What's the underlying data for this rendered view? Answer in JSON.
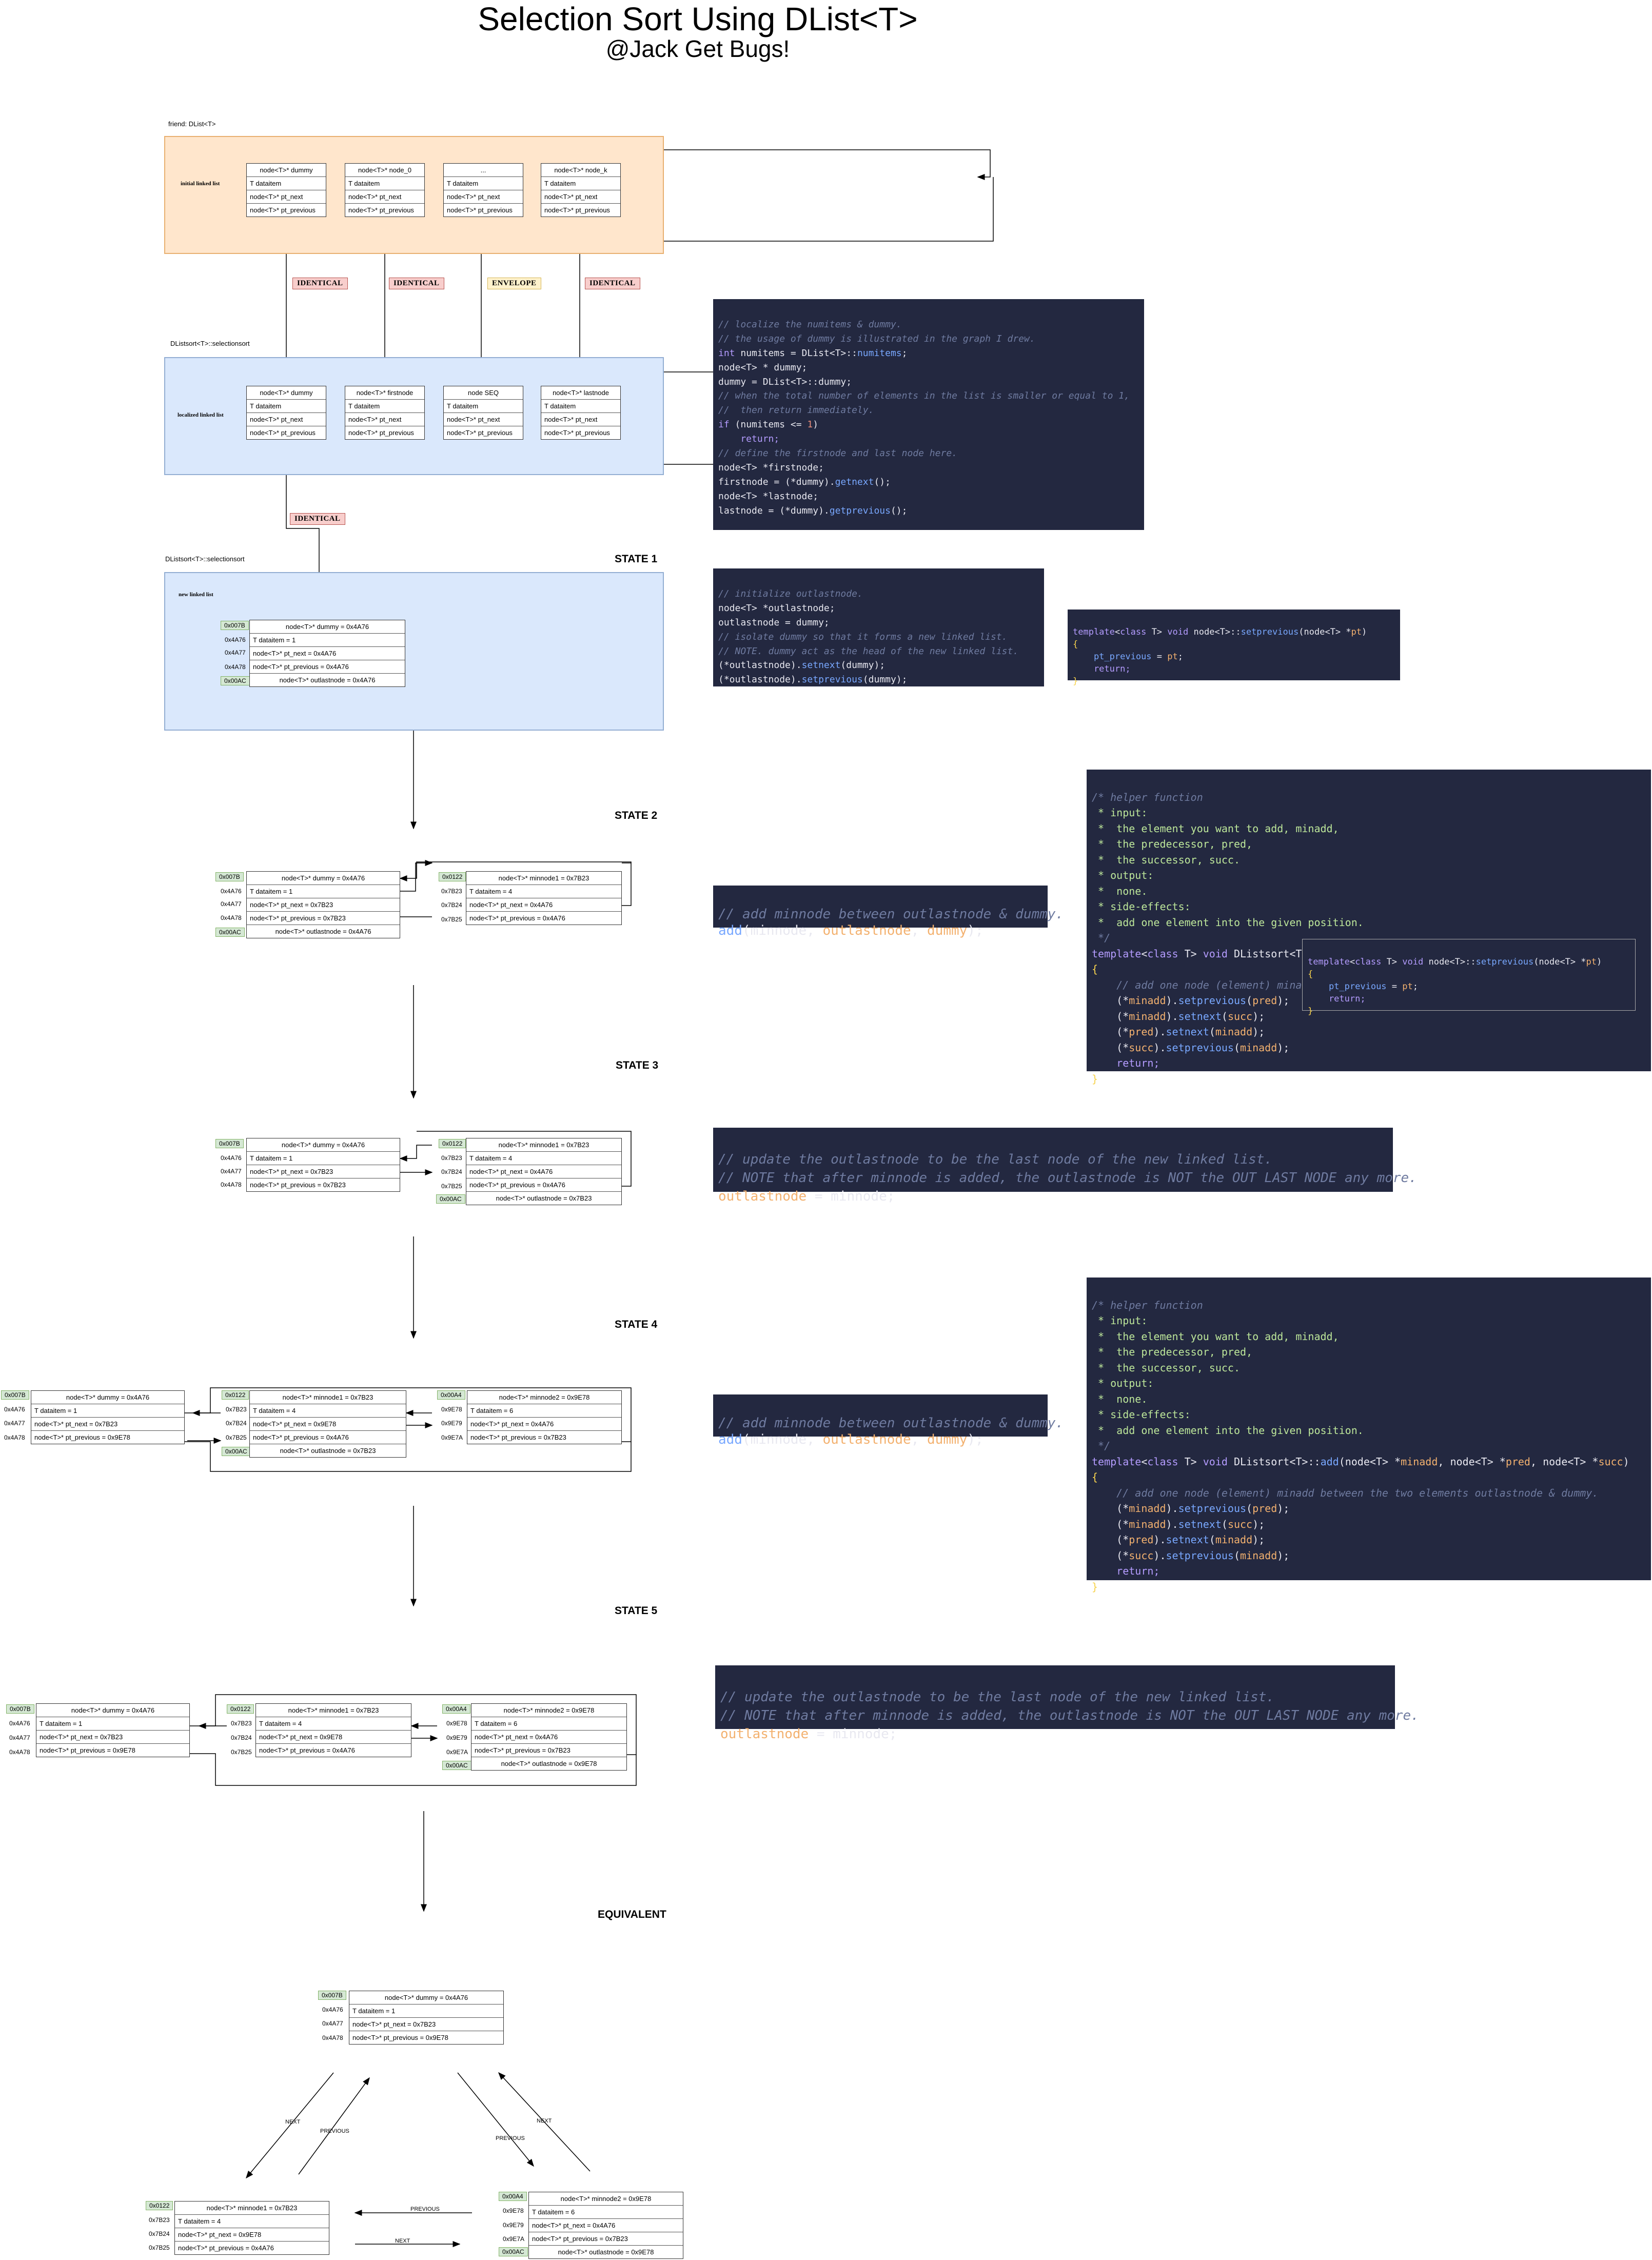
{
  "header": {
    "title": "Selection Sort Using DList<T>",
    "subtitle": "@Jack Get Bugs!"
  },
  "panels": {
    "initial": {
      "caption": "friend: DList<T>",
      "side": "initial linked list"
    },
    "localized": {
      "caption": "DListsort<T>::selectionsort",
      "side": "localized linked list"
    },
    "newlist": {
      "caption": "DListsort<T>::selectionsort",
      "side": "new linked list"
    }
  },
  "badges": [
    "IDENTICAL",
    "IDENTICAL",
    "ENVELOPE",
    "IDENTICAL",
    "IDENTICAL"
  ],
  "states": [
    "STATE 1",
    "STATE 2",
    "STATE 3",
    "STATE 4",
    "STATE 5",
    "EQUIVALENT"
  ],
  "fields": {
    "dataitem": "T dataitem",
    "next": "node<T>* pt_next",
    "prev": "node<T>* pt_previous"
  },
  "top_nodes": [
    "node<T>* dummy",
    "node<T>* node_0",
    "...",
    "node<T>* node_k"
  ],
  "loc_nodes": [
    "node<T>* dummy",
    "node<T>* firstnode",
    "node SEQ",
    "node<T>* lastnode"
  ],
  "nodes": {
    "dummy": "node<T>* dummy = 0x4A76",
    "outlast": "node<T>* outlastnode = 0x4A76",
    "min1": "node<T>* minnode1 = 0x7B23",
    "outlast_min1": "node<T>* outlastnode = 0x7B23",
    "min2": "node<T>* minnode2 = 0x9E78",
    "outlast_min2": "node<T>* outlastnode = 0x9E78",
    "d1": "T dataitem = 1",
    "d4": "T dataitem = 4",
    "d6": "T dataitem = 6",
    "n_4A76": "node<T>* pt_next = 0x4A76",
    "n_7B23": "node<T>* pt_next = 0x7B23",
    "n_9E78": "node<T>* pt_next = 0x9E78",
    "p_4A76": "node<T>* pt_previous = 0x4A76",
    "p_7B23": "node<T>* pt_previous = 0x7B23",
    "p_9E78": "node<T>* pt_previous = 0x9E78"
  },
  "addresses": {
    "a007B": "0x007B",
    "a00AC": "0x00AC",
    "a0122": "0x0122",
    "a00A4": "0x00A4",
    "a4A76": "0x4A76",
    "a4A77": "0x4A77",
    "a4A78": "0x4A78",
    "a7B23": "0x7B23",
    "a7B24": "0x7B24",
    "a7B25": "0x7B25",
    "a9E78": "0x9E78",
    "a9E79": "0x9E79",
    "a9E7A": "0x9E7A"
  },
  "arrow_labels": {
    "next": "NEXT",
    "previous": "PREVIOUS"
  },
  "code": {
    "c1": [
      "// localize the numitems & dummy.",
      "// the usage of dummy is illustrated in the graph I drew.",
      "int numitems = DList<T>::numitems;",
      "node<T> * dummy;",
      "dummy = DList<T>::dummy;",
      "",
      "// when the total number of elements in the list is smaller or equal to 1,",
      "//  then return immediately.",
      "if (numitems <= 1)",
      "    return;",
      "",
      "// define the firstnode and last node here.",
      "node<T> *firstnode;",
      "firstnode = (*dummy).getnext();",
      "node<T> *lastnode;",
      "lastnode = (*dummy).getprevious();"
    ],
    "c2": [
      "// initialize outlastnode.",
      "node<T> *outlastnode;",
      "outlastnode = dummy;",
      "",
      "// isolate dummy so that it forms a new linked list.",
      "// NOTE. dummy act as the head of the new linked list.",
      "(*outlastnode).setnext(dummy);",
      "(*outlastnode).setprevious(dummy);"
    ],
    "c3": [
      "template<class T> void node<T>::setprevious(node<T> *pt)",
      "{",
      "    pt_previous = pt;",
      "    return;",
      "}"
    ],
    "c4": [
      "// add minnode between outlastnode & dummy.",
      "add(minnode, outlastnode, dummy);"
    ],
    "c5": [
      "/* helper function",
      " * input:",
      " *  the element you want to add, minadd,",
      " *  the predecessor, pred,",
      " *  the successor, succ.",
      " * output:",
      " *  none.",
      " * side-effects:",
      " *  add one element into the given position.",
      " */",
      "template<class T> void DListsort<T>::add(node<T> *minadd, node<T> *pred, node<T> *succ)",
      "{",
      "    // add one node (element) minadd between the two elements outlastnode & dummy.",
      "    (*minadd).setprevious(pred);",
      "    (*minadd).setnext(succ);",
      "    (*pred).setnext(minadd);",
      "    (*succ).setprevious(minadd);",
      "    return;",
      "}"
    ],
    "c6": [
      "// update the outlastnode to be the last node of the new linked list.",
      "// NOTE that after minnode is added, the outlastnode is NOT the OUT LAST NODE any more.",
      "outlastnode = minnode;"
    ]
  }
}
